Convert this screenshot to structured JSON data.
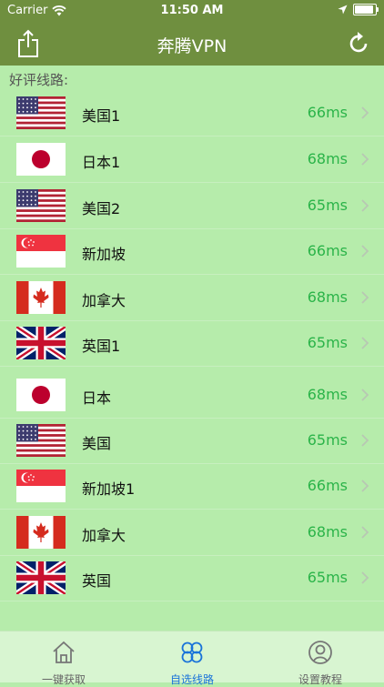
{
  "status_bar": {
    "carrier": "Carrier",
    "time": "11:50 AM"
  },
  "nav": {
    "title": "奔腾VPN",
    "share_icon": "share-icon",
    "refresh_icon": "refresh-icon"
  },
  "section": {
    "header": "好评线路:"
  },
  "servers": [
    {
      "name": "美国1",
      "ping": "66ms",
      "flag": "us"
    },
    {
      "name": "日本1",
      "ping": "68ms",
      "flag": "jp"
    },
    {
      "name": "美国2",
      "ping": "65ms",
      "flag": "us"
    },
    {
      "name": "新加坡",
      "ping": "66ms",
      "flag": "sg"
    },
    {
      "name": "加拿大",
      "ping": "68ms",
      "flag": "ca"
    },
    {
      "name": "英国1",
      "ping": "65ms",
      "flag": "uk"
    },
    {
      "name": "日本",
      "ping": "68ms",
      "flag": "jp"
    },
    {
      "name": "美国",
      "ping": "65ms",
      "flag": "us"
    },
    {
      "name": "新加坡1",
      "ping": "66ms",
      "flag": "sg"
    },
    {
      "name": "加拿大",
      "ping": "68ms",
      "flag": "ca"
    },
    {
      "name": "英国",
      "ping": "65ms",
      "flag": "uk"
    }
  ],
  "tabs": [
    {
      "label": "一键获取",
      "icon": "home-icon",
      "active": false
    },
    {
      "label": "自选线路",
      "icon": "clover-icon",
      "active": true
    },
    {
      "label": "设置教程",
      "icon": "user-icon",
      "active": false
    }
  ],
  "colors": {
    "nav": "#6f8f3f",
    "background": "#b6ecab",
    "ping": "#2bb449",
    "active_tab": "#1a73d9"
  }
}
